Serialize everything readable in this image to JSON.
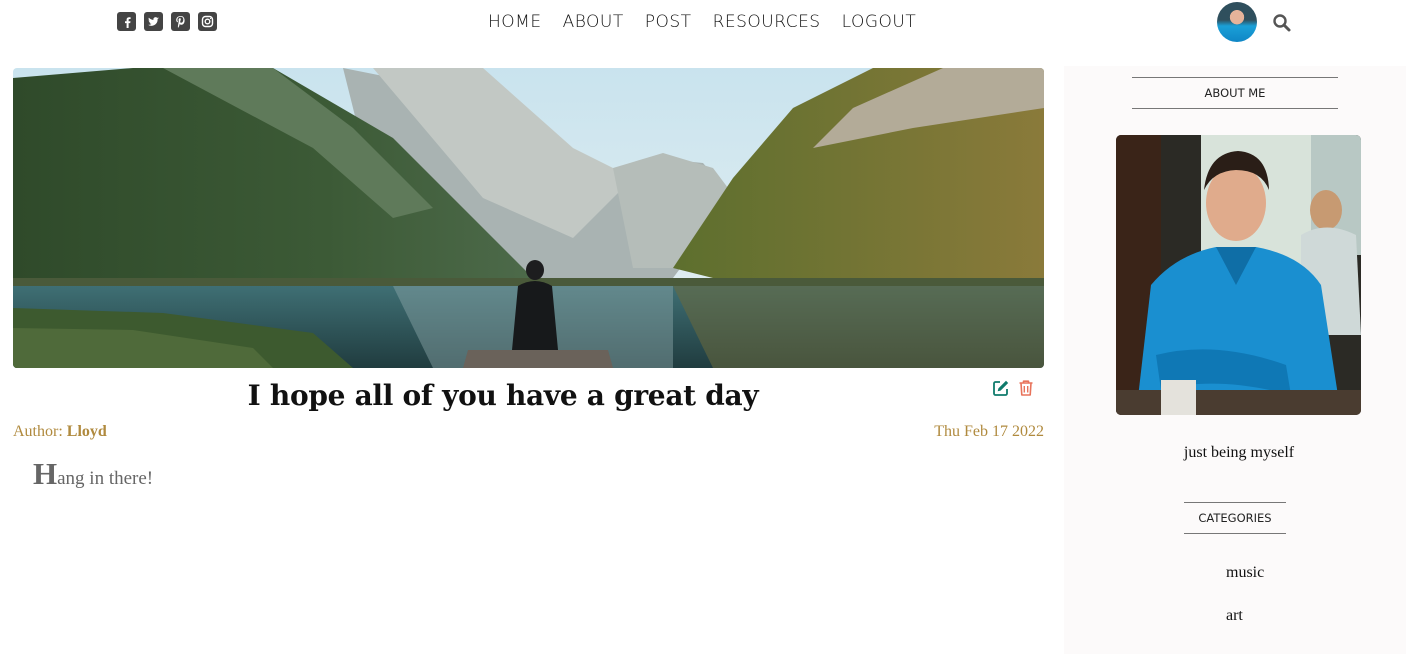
{
  "social": {
    "icons": [
      "facebook-square-icon",
      "twitter-square-icon",
      "pinterest-square-icon",
      "instagram-icon"
    ]
  },
  "nav": {
    "items": [
      "HOME",
      "ABOUT",
      "POST",
      "RESOURCES",
      "LOGOUT"
    ]
  },
  "header_right": {
    "avatar": "user-avatar",
    "search_icon": "search-icon"
  },
  "post": {
    "title": "I hope all of you have a great day",
    "author_label": "Author:",
    "author_name": "Lloyd",
    "date": "Thu Feb 17 2022",
    "body_first_letter": "H",
    "body_rest": "ang in there!",
    "edit_icon": "edit-icon",
    "delete_icon": "trash-icon",
    "edit_color": "#0f7b6c",
    "delete_color": "#e8735b"
  },
  "sidebar": {
    "about_heading": "ABOUT ME",
    "bio": "just being myself",
    "categories_heading": "CATEGORIES",
    "categories": [
      "music",
      "art"
    ]
  },
  "colors": {
    "meta_gold": "#b08a3e",
    "sidebar_bg": "#fcfafa"
  }
}
